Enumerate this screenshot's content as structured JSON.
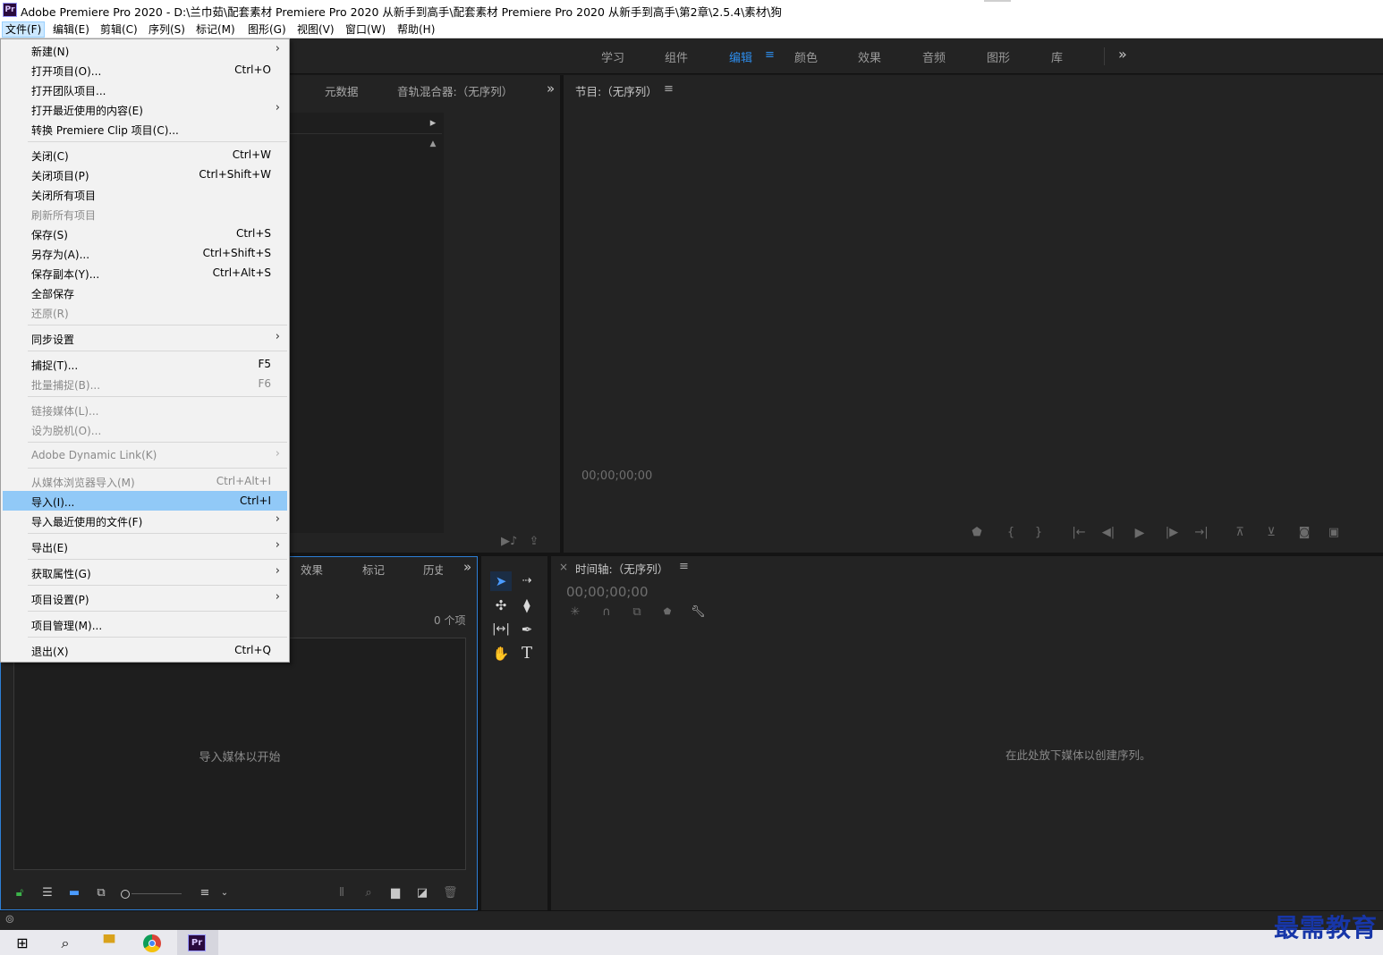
{
  "window": {
    "app_icon_text": "Pr",
    "title": "Adobe Premiere Pro 2020 - D:\\兰巾茹\\配套素材 Premiere Pro 2020 从新手到高手\\配套素材 Premiere Pro 2020 从新手到高手\\第2章\\2.5.4\\素材\\狗"
  },
  "menubar": {
    "items": [
      "文件(F)",
      "编辑(E)",
      "剪辑(C)",
      "序列(S)",
      "标记(M)",
      "图形(G)",
      "视图(V)",
      "窗口(W)",
      "帮助(H)"
    ],
    "active_index": 0
  },
  "workspaces": {
    "tabs": [
      "学习",
      "组件",
      "编辑",
      "颜色",
      "效果",
      "音频",
      "图形",
      "库"
    ],
    "active": "编辑",
    "more": "»"
  },
  "upper_left_panel": {
    "tabs": [
      "元数据",
      "音轨混合器:（无序列）"
    ],
    "more": "»"
  },
  "program_monitor": {
    "title": "节目:（无序列）",
    "menu_icon": "≡",
    "timecode": "00;00;00;00",
    "controls": [
      "add-marker-icon",
      "mark-in-icon",
      "mark-out-icon",
      "go-to-in-icon",
      "step-back-icon",
      "play-icon",
      "step-forward-icon",
      "go-to-out-icon",
      "lift-icon",
      "extract-icon",
      "export-frame-icon",
      "comparison-view-icon"
    ]
  },
  "project_panel": {
    "tabs": [
      "效果",
      "标记",
      "历史"
    ],
    "more": "»",
    "item_count": "0 个项",
    "empty_message": "导入媒体以开始"
  },
  "tools": [
    "selection-tool-icon",
    "track-select-tool-icon",
    "ripple-edit-tool-icon",
    "razor-tool-icon",
    "slip-tool-icon",
    "pen-tool-icon",
    "hand-tool-icon",
    "type-tool-icon"
  ],
  "timeline": {
    "close": "×",
    "title": "时间轴:（无序列）",
    "menu_icon": "≡",
    "timecode": "00;00;00;00",
    "empty_message": "在此处放下媒体以创建序列。"
  },
  "file_menu": {
    "items": [
      {
        "label": "新建(N)",
        "shortcut": "",
        "submenu": true,
        "enabled": true
      },
      {
        "label": "打开项目(O)...",
        "shortcut": "Ctrl+O",
        "submenu": false,
        "enabled": true
      },
      {
        "label": "打开团队项目...",
        "shortcut": "",
        "submenu": false,
        "enabled": true
      },
      {
        "label": "打开最近使用的内容(E)",
        "shortcut": "",
        "submenu": true,
        "enabled": true
      },
      {
        "label": "转换 Premiere Clip 项目(C)...",
        "shortcut": "",
        "submenu": false,
        "enabled": true
      },
      {
        "separator": true
      },
      {
        "label": "关闭(C)",
        "shortcut": "Ctrl+W",
        "submenu": false,
        "enabled": true
      },
      {
        "label": "关闭项目(P)",
        "shortcut": "Ctrl+Shift+W",
        "submenu": false,
        "enabled": true
      },
      {
        "label": "关闭所有项目",
        "shortcut": "",
        "submenu": false,
        "enabled": true
      },
      {
        "label": "刷新所有项目",
        "shortcut": "",
        "submenu": false,
        "enabled": false
      },
      {
        "label": "保存(S)",
        "shortcut": "Ctrl+S",
        "submenu": false,
        "enabled": true
      },
      {
        "label": "另存为(A)...",
        "shortcut": "Ctrl+Shift+S",
        "submenu": false,
        "enabled": true
      },
      {
        "label": "保存副本(Y)...",
        "shortcut": "Ctrl+Alt+S",
        "submenu": false,
        "enabled": true
      },
      {
        "label": "全部保存",
        "shortcut": "",
        "submenu": false,
        "enabled": true
      },
      {
        "label": "还原(R)",
        "shortcut": "",
        "submenu": false,
        "enabled": false
      },
      {
        "separator": true
      },
      {
        "label": "同步设置",
        "shortcut": "",
        "submenu": true,
        "enabled": true
      },
      {
        "separator": true
      },
      {
        "label": "捕捉(T)...",
        "shortcut": "F5",
        "submenu": false,
        "enabled": true
      },
      {
        "label": "批量捕捉(B)...",
        "shortcut": "F6",
        "submenu": false,
        "enabled": false
      },
      {
        "separator": true
      },
      {
        "label": "链接媒体(L)...",
        "shortcut": "",
        "submenu": false,
        "enabled": false
      },
      {
        "label": "设为脱机(O)...",
        "shortcut": "",
        "submenu": false,
        "enabled": false
      },
      {
        "separator": true
      },
      {
        "label": "Adobe Dynamic Link(K)",
        "shortcut": "",
        "submenu": true,
        "enabled": false
      },
      {
        "separator": true
      },
      {
        "label": "从媒体浏览器导入(M)",
        "shortcut": "Ctrl+Alt+I",
        "submenu": false,
        "enabled": false
      },
      {
        "label": "导入(I)...",
        "shortcut": "Ctrl+I",
        "submenu": false,
        "enabled": true,
        "highlighted": true
      },
      {
        "label": "导入最近使用的文件(F)",
        "shortcut": "",
        "submenu": true,
        "enabled": true
      },
      {
        "separator": true
      },
      {
        "label": "导出(E)",
        "shortcut": "",
        "submenu": true,
        "enabled": true
      },
      {
        "separator": true
      },
      {
        "label": "获取属性(G)",
        "shortcut": "",
        "submenu": true,
        "enabled": true
      },
      {
        "separator": true
      },
      {
        "label": "项目设置(P)",
        "shortcut": "",
        "submenu": true,
        "enabled": true
      },
      {
        "separator": true
      },
      {
        "label": "项目管理(M)...",
        "shortcut": "",
        "submenu": false,
        "enabled": true
      },
      {
        "separator": true
      },
      {
        "label": "退出(X)",
        "shortcut": "Ctrl+Q",
        "submenu": false,
        "enabled": true
      }
    ]
  },
  "taskbar": {
    "items": [
      "windows-start-icon",
      "search-icon",
      "file-explorer-icon",
      "chrome-icon",
      "premiere-pro-icon"
    ],
    "premiere_label": "Pr"
  },
  "watermark": "最需教育",
  "colors": {
    "accent_blue": "#2d8ceb",
    "menu_highlight": "#91c9f7",
    "panel_bg": "#232323"
  }
}
